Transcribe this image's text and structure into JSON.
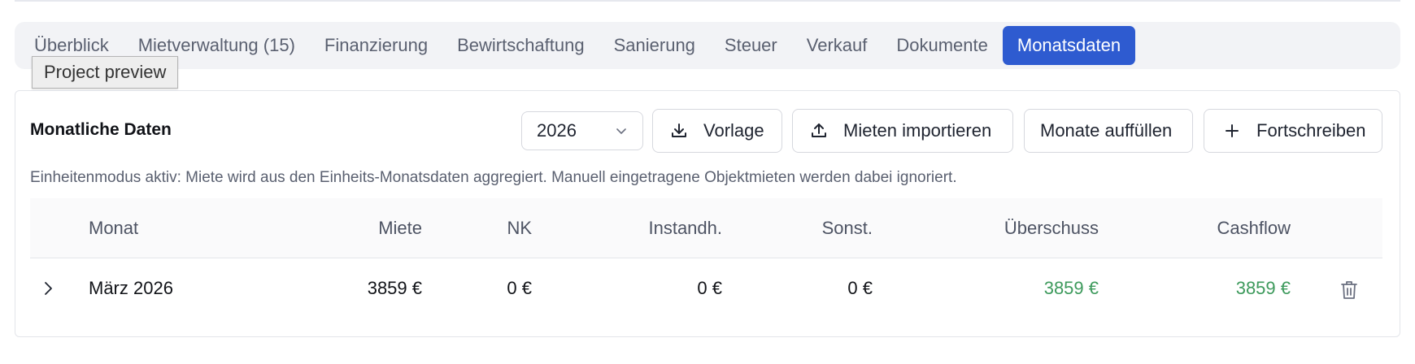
{
  "tabs": [
    {
      "label": "Überblick",
      "active": false
    },
    {
      "label": "Mietverwaltung (15)",
      "active": false
    },
    {
      "label": "Finanzierung",
      "active": false
    },
    {
      "label": "Bewirtschaftung",
      "active": false
    },
    {
      "label": "Sanierung",
      "active": false
    },
    {
      "label": "Steuer",
      "active": false
    },
    {
      "label": "Verkauf",
      "active": false
    },
    {
      "label": "Dokumente",
      "active": false
    },
    {
      "label": "Monatsdaten",
      "active": true
    }
  ],
  "tooltip": "Project preview",
  "card": {
    "title": "Monatliche Daten",
    "year_select": "2026",
    "buttons": {
      "template": "Vorlage",
      "import": "Mieten importieren",
      "fill": "Monate auffüllen",
      "extend": "Fortschreiben"
    },
    "info": "Einheitenmodus aktiv: Miete wird aus den Einheits-Monatsdaten aggregiert. Manuell eingetragene Objektmieten werden dabei ignoriert."
  },
  "table": {
    "headers": {
      "month": "Monat",
      "rent": "Miete",
      "nk": "NK",
      "maintenance": "Instandh.",
      "other": "Sonst.",
      "surplus": "Überschuss",
      "cashflow": "Cashflow"
    },
    "rows": [
      {
        "month": "März 2026",
        "rent": "3859 €",
        "nk": "0 €",
        "maintenance": "0 €",
        "other": "0 €",
        "surplus": "3859 €",
        "cashflow": "3859 €"
      }
    ]
  },
  "colors": {
    "accent": "#2e5bd0",
    "positive": "#3d9a5c"
  }
}
